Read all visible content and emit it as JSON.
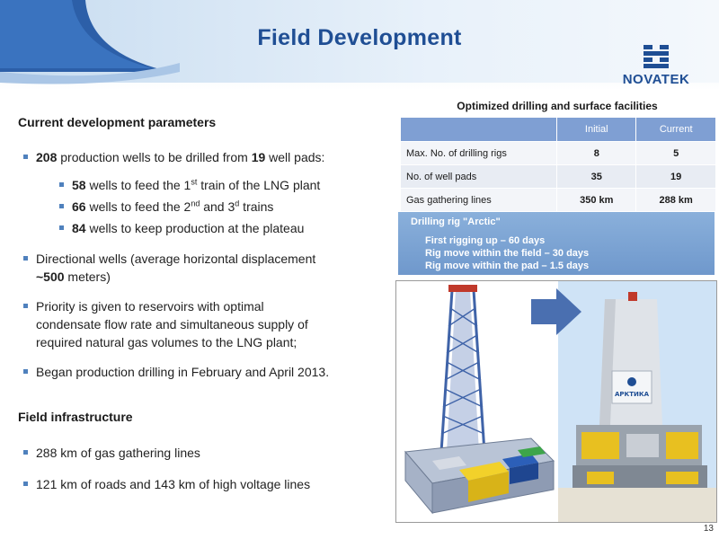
{
  "header": {
    "title": "Field Development"
  },
  "logo": {
    "text": "NOVATEK",
    "icon": "novatek-logo-icon",
    "color": "#1f4e94"
  },
  "current": {
    "heading": "Current development parameters",
    "b1": {
      "n1": "208",
      "t1": " production wells to be drilled from ",
      "n2": "19",
      "t2": " well pads:"
    },
    "s1": {
      "n": "58",
      "t1": " wells to feed the 1",
      "sup": "st",
      "t2": " train of the LNG plant"
    },
    "s2": {
      "n": "66",
      "t1": " wells to feed the 2",
      "sup1": "nd",
      "t2": " and 3",
      "sup2": "d",
      "t3": " trains"
    },
    "s3": {
      "n": "84",
      "t": " wells to keep production at the plateau"
    },
    "b2": {
      "t1": "Directional wells (average horizontal displacement",
      "n": "~500",
      "t2": " meters)"
    },
    "b3": {
      "l1": "Priority is given to reservoirs with optimal",
      "l2": "condensate flow rate and simultaneous supply of",
      "l3": "required natural gas volumes to the LNG plant;"
    },
    "b4": "Began production drilling in February and April 2013."
  },
  "infra": {
    "heading": "Field infrastructure",
    "b1": "288 km of gas gathering  lines",
    "b2": "121 km of roads and 143 km of high voltage lines"
  },
  "table": {
    "title": "Optimized drilling and surface facilities",
    "headers": [
      "",
      "Initial",
      "Current"
    ],
    "rows": [
      {
        "label": "Max. No. of drilling rigs",
        "initial": "8",
        "current": "5"
      },
      {
        "label": "No. of well pads",
        "initial": "35",
        "current": "19"
      },
      {
        "label": "Gas gathering lines",
        "initial": "350 km",
        "current": "288 km"
      }
    ]
  },
  "rig": {
    "title": "Drilling rig \"Arctic\"",
    "l1": "First rigging up – 60 days",
    "l2": "Rig move within the field – 30 days",
    "l3": "Rig move within the pad – 1.5 days"
  },
  "photo": {
    "sign": "АРКТИКА",
    "colors": {
      "frame": "#4a6fb0",
      "yellow": "#e8c020",
      "sky": "#cfe3f6"
    }
  },
  "page": {
    "number": "13"
  },
  "colors": {
    "accent": "#1f4e94",
    "bullet": "#4f81bd",
    "table_header": "#7f9fd3",
    "rig_box": "#6f98cc"
  }
}
